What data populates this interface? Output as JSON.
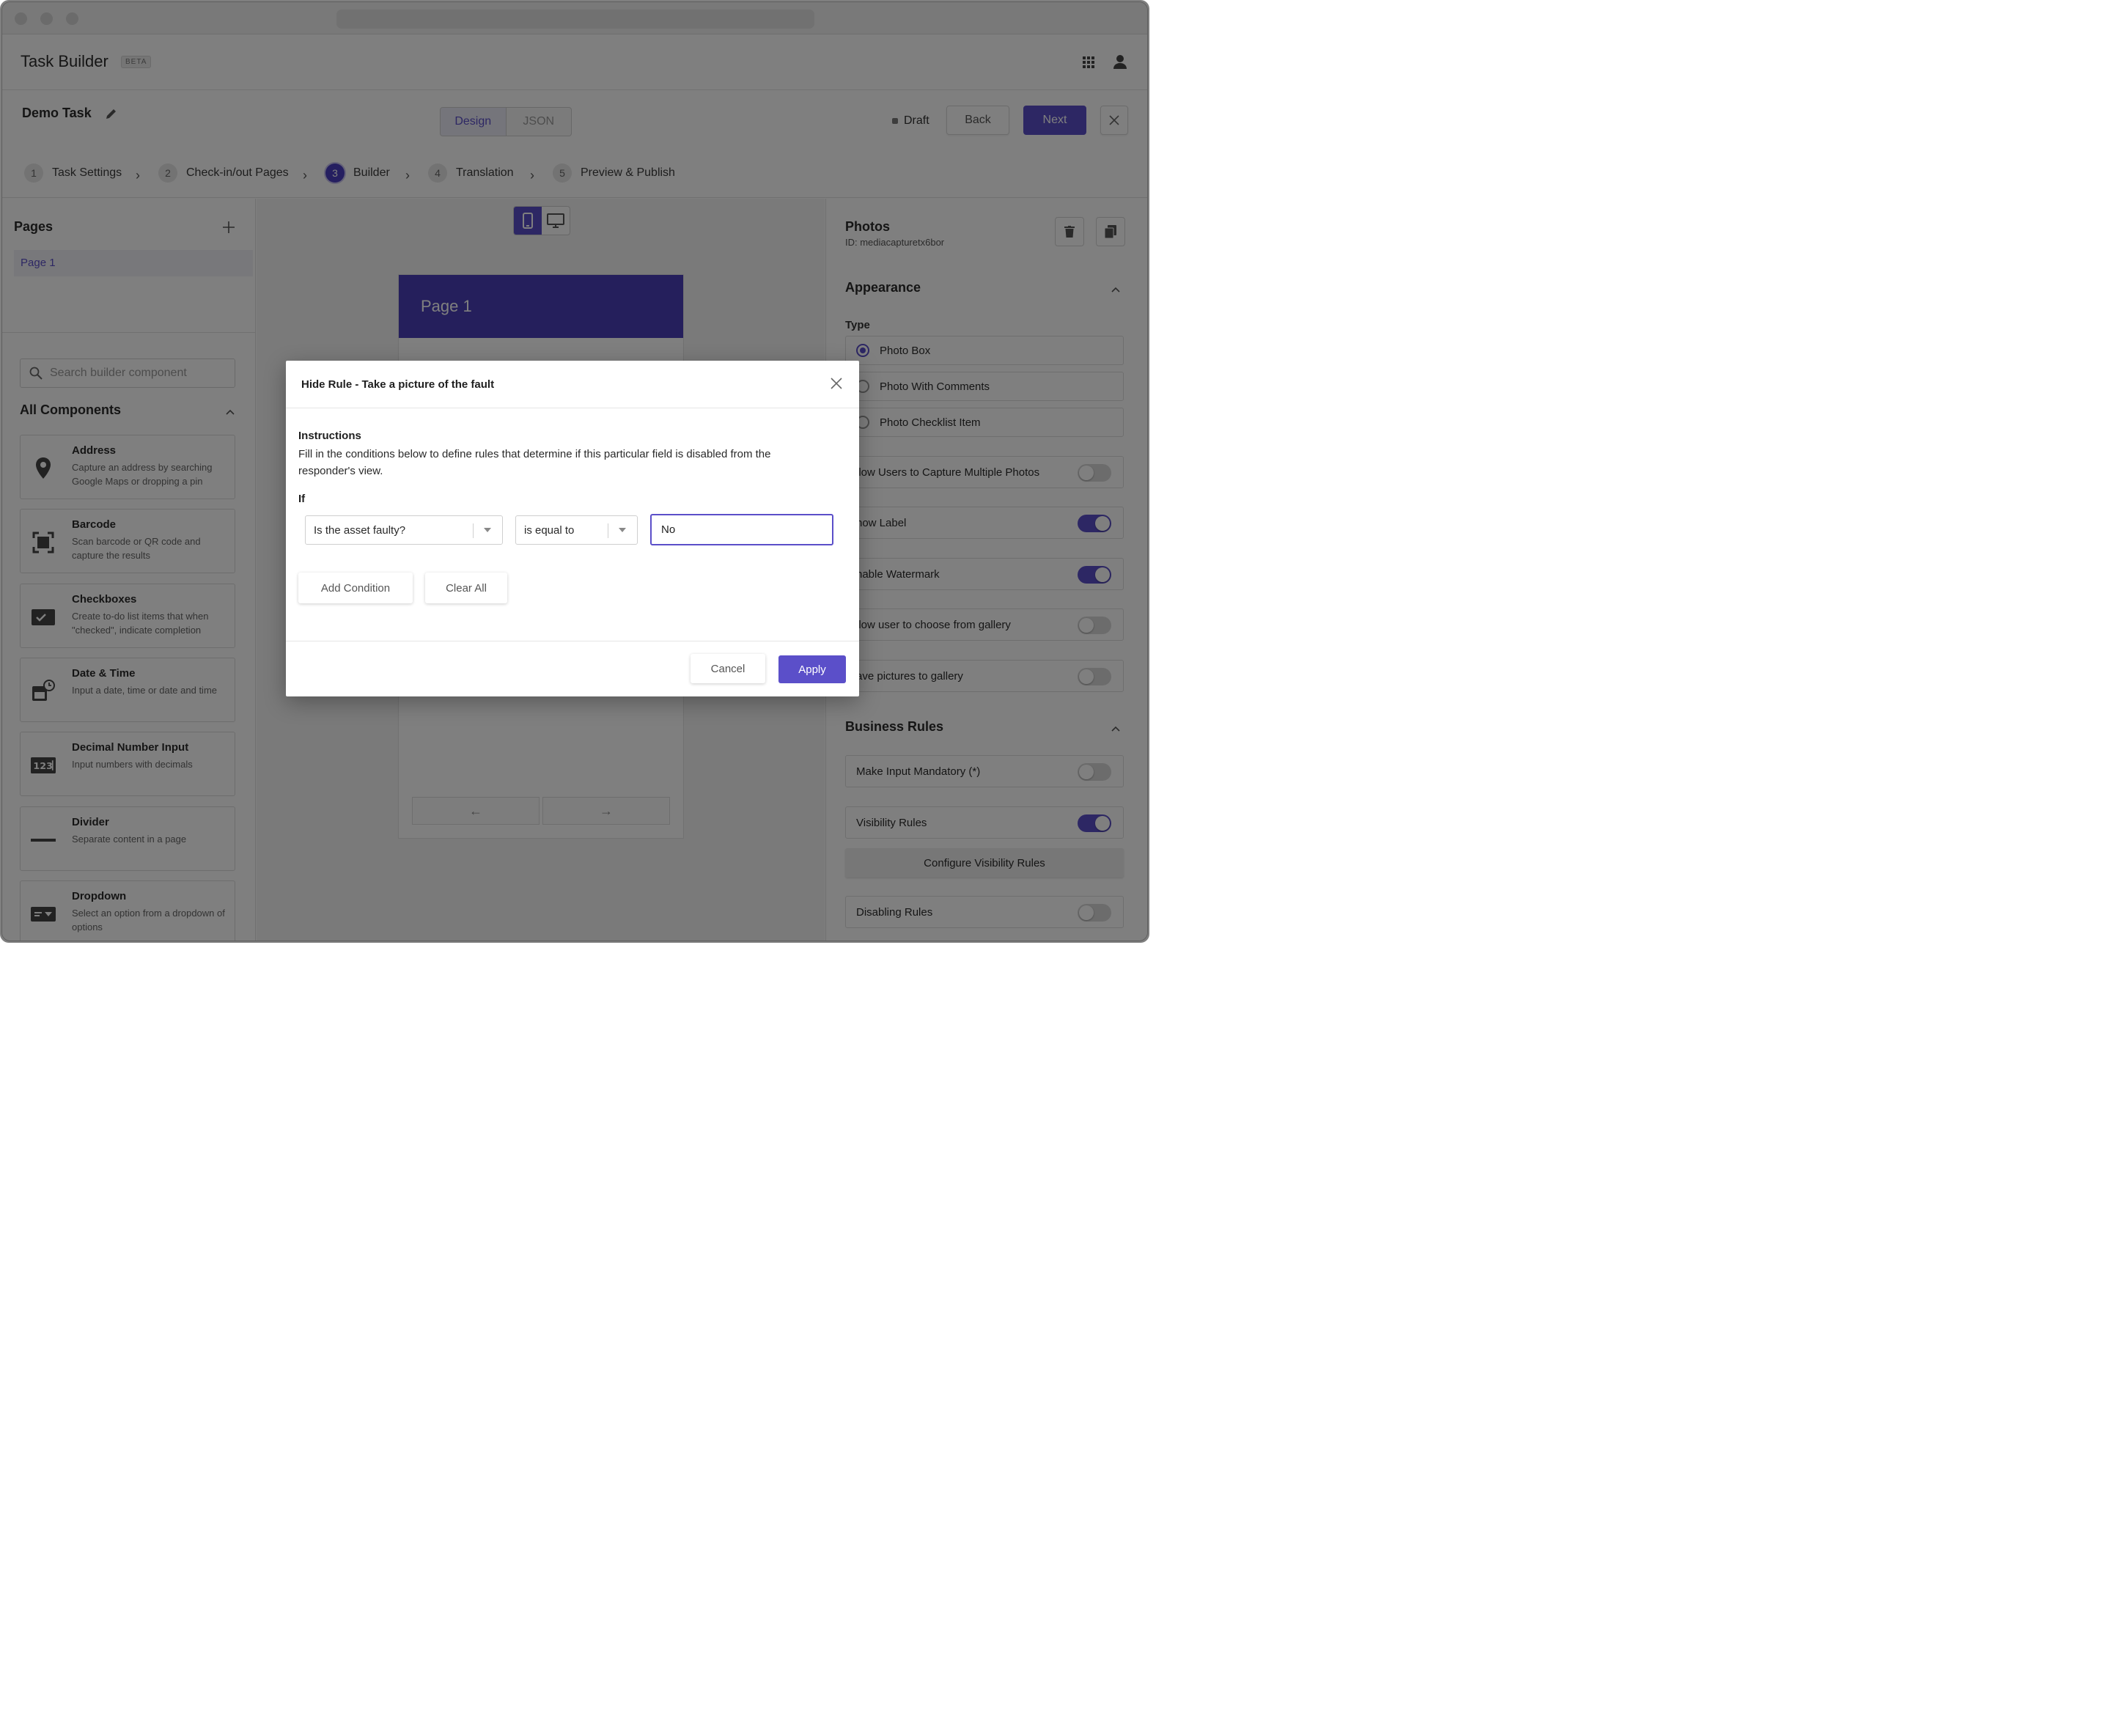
{
  "app": {
    "title": "Task Builder",
    "badge": "BETA"
  },
  "task": {
    "name": "Demo Task",
    "status": "Draft"
  },
  "view_modes": [
    "Design",
    "JSON"
  ],
  "actions": {
    "back": "Back",
    "next": "Next"
  },
  "steps": [
    {
      "num": "1",
      "label": "Task Settings"
    },
    {
      "num": "2",
      "label": "Check-in/out Pages"
    },
    {
      "num": "3",
      "label": "Builder"
    },
    {
      "num": "4",
      "label": "Translation"
    },
    {
      "num": "5",
      "label": "Preview & Publish"
    }
  ],
  "pages": {
    "title": "Pages",
    "items": [
      "Page 1"
    ]
  },
  "components": {
    "search_placeholder": "Search builder component",
    "section_title": "All Components",
    "items": [
      {
        "title": "Address",
        "desc": "Capture an address by searching Google Maps or dropping a pin",
        "icon": "location-pin-icon"
      },
      {
        "title": "Barcode",
        "desc": "Scan barcode or QR code and capture the results",
        "icon": "barcode-scan-icon"
      },
      {
        "title": "Checkboxes",
        "desc": "Create to-do list items that when \"checked\", indicate completion",
        "icon": "checkbox-icon"
      },
      {
        "title": "Date & Time",
        "desc": "Input a date, time or date and time",
        "icon": "calendar-clock-icon"
      },
      {
        "title": "Decimal Number Input",
        "desc": "Input numbers with decimals",
        "icon": "number-123-icon"
      },
      {
        "title": "Divider",
        "desc": "Separate content in a page",
        "icon": "divider-line-icon"
      },
      {
        "title": "Dropdown",
        "desc": "Select an option from a dropdown of options",
        "icon": "dropdown-icon"
      }
    ]
  },
  "preview": {
    "page_title": "Page 1"
  },
  "properties": {
    "title": "Photos",
    "id": "ID: mediacapturetx6bor",
    "appearance": {
      "title": "Appearance",
      "type_label": "Type",
      "types": [
        "Photo Box",
        "Photo With Comments",
        "Photo Checklist Item"
      ],
      "selected_type": "Photo Box",
      "toggles": [
        {
          "label": "llow Users to Capture Multiple Photos",
          "on": false
        },
        {
          "label": "how Label",
          "on": true
        },
        {
          "label": "nable Watermark",
          "on": true
        },
        {
          "label": "llow user to choose from gallery",
          "on": false
        },
        {
          "label": "ave pictures to gallery",
          "on": false
        }
      ]
    },
    "business_rules": {
      "title": "Business Rules",
      "mandatory": {
        "label": "Make Input Mandatory (*)",
        "on": false
      },
      "visibility": {
        "label": "Visibility Rules",
        "on": true
      },
      "configure_label": "Configure Visibility Rules",
      "disabling": {
        "label": "Disabling Rules",
        "on": false
      }
    }
  },
  "modal": {
    "title": "Hide Rule - Take a picture of the fault",
    "instructions_title": "Instructions",
    "instructions": "Fill in the conditions below to define rules that determine if this particular field is disabled from the responder's view.",
    "if_label": "If",
    "field_value": "Is the asset faulty?",
    "operator_value": "is equal to",
    "input_value": "No",
    "add_condition": "Add Condition",
    "clear_all": "Clear All",
    "cancel": "Cancel",
    "apply": "Apply"
  },
  "colors": {
    "accent": "#5b4fc9",
    "header": "#4a3fb8"
  }
}
